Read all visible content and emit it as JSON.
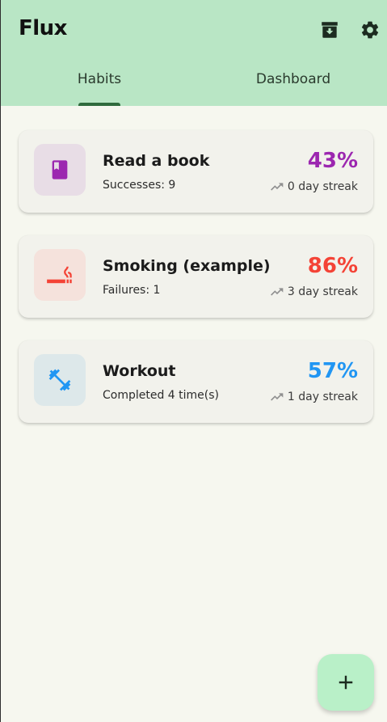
{
  "app": {
    "title": "Flux"
  },
  "header": {
    "archive_icon": "archive-icon",
    "settings_icon": "gear-icon"
  },
  "tabs": [
    {
      "label": "Habits",
      "active": true
    },
    {
      "label": "Dashboard",
      "active": false
    }
  ],
  "habits": [
    {
      "name": "Read a book",
      "subtitle": "Successes: 9",
      "percent": "43%",
      "streak": "0 day streak",
      "icon": "book-icon",
      "color": "#9c27b0",
      "icon_bg": "#e8dde6"
    },
    {
      "name": "Smoking (example)",
      "subtitle": "Failures: 1",
      "percent": "86%",
      "streak": "3 day streak",
      "icon": "smoking-icon",
      "color": "#f44336",
      "icon_bg": "#f5e2dc"
    },
    {
      "name": "Workout",
      "subtitle": "Completed 4 time(s)",
      "percent": "57%",
      "streak": "1 day streak",
      "icon": "dumbbell-icon",
      "color": "#2196f3",
      "icon_bg": "#dde8ea"
    }
  ],
  "fab": {
    "label": "+",
    "icon": "plus-icon"
  },
  "colors": {
    "header_bg": "#b9e6c5",
    "page_bg": "#f6f7ef",
    "fab_bg": "#b9f0c8",
    "tab_indicator": "#2f6b3d"
  }
}
